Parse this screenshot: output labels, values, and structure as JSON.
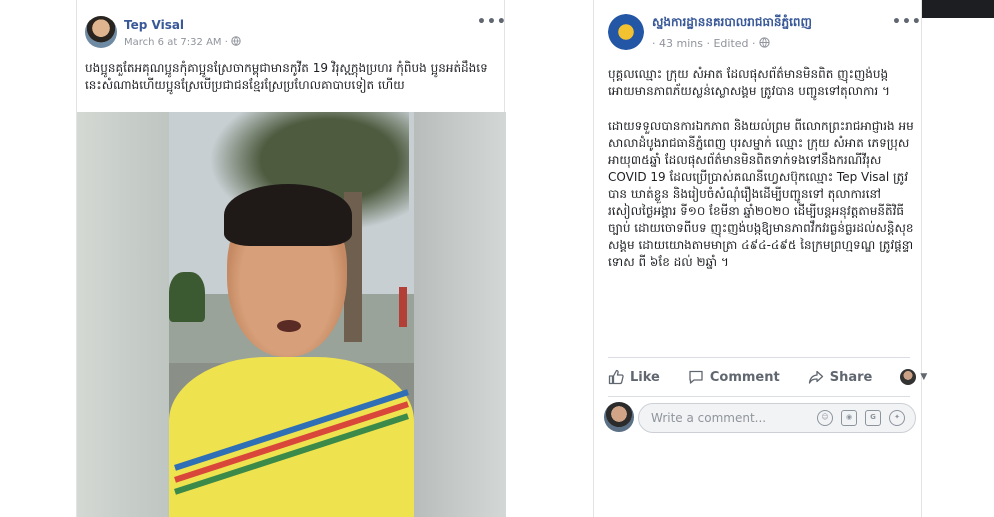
{
  "left_post": {
    "author": "Tep Visal",
    "timestamp": "March 6 at 7:32 AM",
    "privacy_sep": "·",
    "more_label": "•••",
    "text": "បងប្អូនគួតែអគុណប្អូនកុំគាប្អូនស្រែចាកម្ពុជាមានកូវីត 19 វិរុសក្ណុងប្រហរ កុំពិបង ប្អូនអត់ដឹងទេ នេះសំណាងហើយប្អូនស្រែបើប្រជាជនខ្មែរស្រែប្រហែលគាបាបទៀត ហើយ"
  },
  "right_post": {
    "author": "ស្នងការដ្ឋាននគរបាលរាជធានីភ្នំពេញ",
    "timestamp": "43 mins",
    "edited": "Edited",
    "meta_sep": "·",
    "more_label": "•••",
    "paragraph_1": "បុគ្គលឈ្មោះ ក្រុយ សំអាត ដែលផុសព័ត៌មានមិនពិត ញុះញង់បង្កអោយមានភាពភ័យស្លន់ស្លោសង្គម ត្រូវបាន បញ្ជូនទៅតុលាការ ។",
    "paragraph_2": "ដោយទទួលបានការឯកភាព និងយល់ព្រម ពីលោកព្រះរាជអាជ្ញារង អមសាលាដំបូងរាជធានីភ្នំពេញ បុរសម្នាក់ ឈ្មោះ ក្រុយ សំអាត ភេទប្រុស អាយុ៣៥ឆ្នាំ ដែលផុសព័ត៌មានមិនពិតទាក់ទងទៅនឹងករណីវីរុស COVID 19 ដែលប្រើប្រាស់គណនីហ្វេសប៊ុកឈ្មោះ Tep Visal ត្រូវបាន ឃាត់ខ្លួន និងរៀបចំសំណុំរឿងដើម្បីបញ្ជូនទៅ តុលាការនៅរសៀលថ្ងៃអង្គារ ទី១០ ខែមីនា ឆ្នាំ២០២០ ដើម្បីបន្តអនុវត្តតាមនីតិវិធីច្បាប់ ដោយចោទពីបទ ញុះញង់បង្កឱ្យមានភាពវឹកវរធ្ងន់ធ្ងរដល់សន្តិសុខសង្គម ដោយយោងតាមមាត្រា ៤៩៤-៤៩៥ នៃក្រមព្រហ្មទណ្ឌ ត្រូវផ្តន្ទាទោស ពី ៦ខែ ដល់ ២ឆ្នាំ ។",
    "actions": {
      "like": "Like",
      "comment": "Comment",
      "share": "Share"
    },
    "comment_placeholder": "Write a comment..."
  },
  "colors": {
    "link_blue": "#385898",
    "meta_gray": "#90949c",
    "action_gray": "#606770"
  }
}
